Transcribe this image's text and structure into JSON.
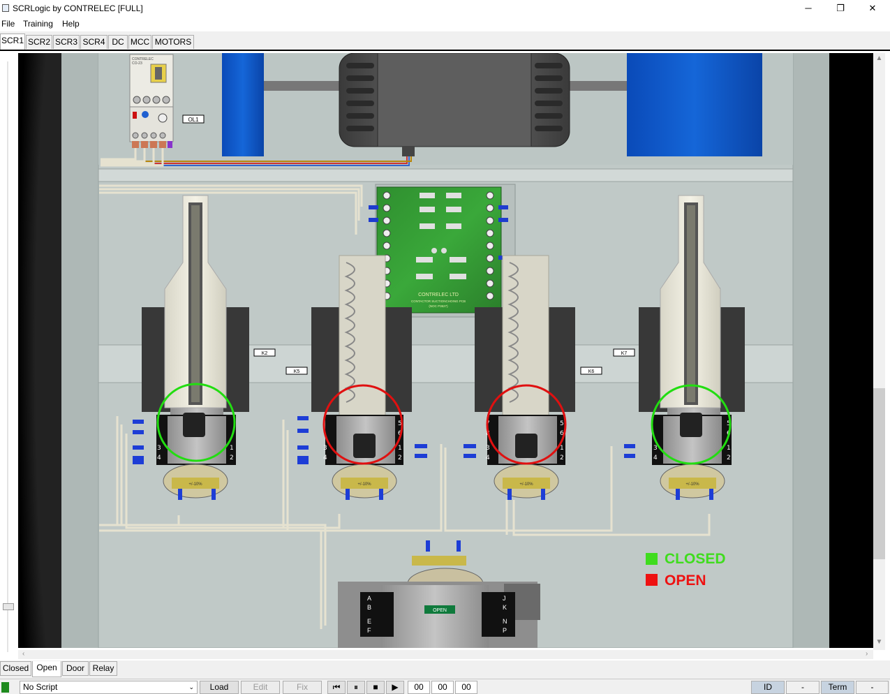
{
  "window": {
    "title": "SCRLogic by CONTRELEC [FULL]",
    "minimize": "─",
    "restore": "❐",
    "close": "✕"
  },
  "menu": [
    "File",
    "Training",
    "Help"
  ],
  "tabs": [
    "SCR1",
    "SCR2",
    "SCR3",
    "SCR4",
    "DC",
    "MCC",
    "MOTORS"
  ],
  "active_tab": "SCR1",
  "diagram": {
    "overload_label": "OL1",
    "contactor_labels": {
      "k2": "K2",
      "k5": "K5",
      "k6": "K6",
      "k7": "K7"
    },
    "pcb": {
      "maker": "CONTRELEC LTD",
      "line1": "CONTACTOR SUCTIONCHOING PCB",
      "line2": "(NOC P3627)"
    },
    "overload_brand": "CONTRELEC",
    "overload_model": "CO-23",
    "door_indicator": "OPEN",
    "resistor_tag": "+/-10%",
    "terminals_left": [
      "A",
      "B",
      "E",
      "F"
    ],
    "terminals_right": [
      "J",
      "K",
      "N",
      "P"
    ],
    "legend": [
      {
        "label": "CLOSED",
        "color": "#3fdc1e"
      },
      {
        "label": "OPEN",
        "color": "#ee1111"
      }
    ],
    "contactor_states": [
      "closed",
      "open",
      "open",
      "closed"
    ],
    "state_colors": {
      "closed": "#22dd11",
      "open": "#e01010"
    }
  },
  "bottom_tabs": [
    "Closed",
    "Open",
    "Door",
    "Relay"
  ],
  "active_bottom_tab": "Open",
  "status": {
    "script": "No Script",
    "load": "Load",
    "edit": "Edit",
    "fix": "Fix",
    "first": "⏮",
    "pause": "⏸",
    "stop": "■",
    "play": "▶",
    "time_h": "00",
    "time_m": "00",
    "time_s": "00",
    "id_label": "ID",
    "id_value": "-",
    "term_label": "Term",
    "term_value": "-"
  }
}
